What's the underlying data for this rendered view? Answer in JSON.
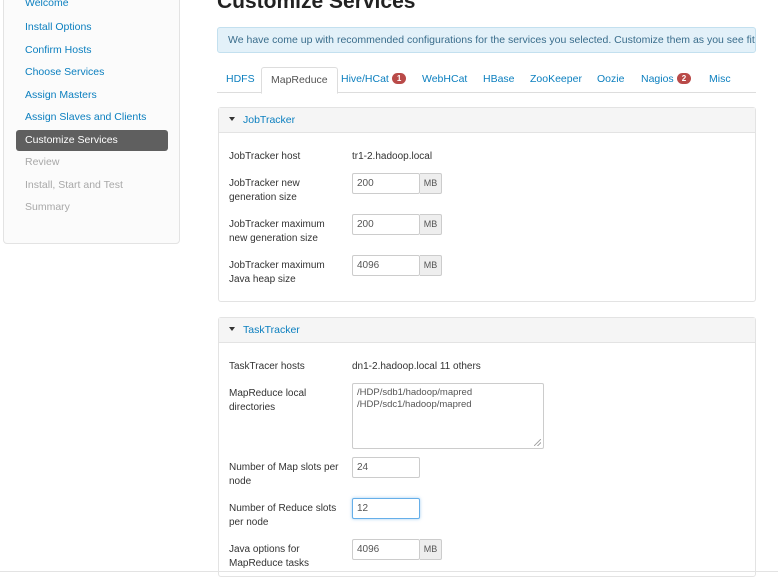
{
  "sidebar": {
    "items": [
      {
        "label": "Welcome"
      },
      {
        "label": "Install Options"
      },
      {
        "label": "Confirm Hosts"
      },
      {
        "label": "Choose Services"
      },
      {
        "label": "Assign Masters"
      },
      {
        "label": "Assign Slaves and Clients"
      },
      {
        "label": "Customize Services"
      },
      {
        "label": "Review"
      },
      {
        "label": "Install, Start and Test"
      },
      {
        "label": "Summary"
      }
    ]
  },
  "page": {
    "title": "Customize Services",
    "alert": "We have come up with recommended configurations for the services you selected. Customize them as you see fit."
  },
  "tabs": [
    {
      "label": "HDFS"
    },
    {
      "label": "MapReduce"
    },
    {
      "label": "Hive/HCat",
      "badge": "1"
    },
    {
      "label": "WebHCat"
    },
    {
      "label": "HBase"
    },
    {
      "label": "ZooKeeper"
    },
    {
      "label": "Oozie"
    },
    {
      "label": "Nagios",
      "badge": "2"
    },
    {
      "label": "Misc"
    }
  ],
  "jobtracker": {
    "title": "JobTracker",
    "host_label": "JobTracker host",
    "host_value": "tr1-2.hadoop.local",
    "newgen_label": "JobTracker new generation size",
    "newgen_value": "200",
    "newgen_unit": "MB",
    "maxnewgen_label": "JobTracker maximum new generation size",
    "maxnewgen_value": "200",
    "maxnewgen_unit": "MB",
    "heap_label": "JobTracker maximum Java heap size",
    "heap_value": "4096",
    "heap_unit": "MB"
  },
  "tasktracker": {
    "title": "TaskTracker",
    "hosts_label": "TaskTracer hosts",
    "hosts_value": "dn1-2.hadoop.local 11 others",
    "localdirs_label": "MapReduce local directories",
    "localdirs_value": "/HDP/sdb1/hadoop/mapred\n/HDP/sdc1/hadoop/mapred",
    "mapslots_label": "Number of Map slots per node",
    "mapslots_value": "24",
    "reduceslots_label": "Number of Reduce slots per node",
    "reduceslots_value": "12",
    "javaopts_label": "Java options for MapReduce tasks",
    "javaopts_value": "4096",
    "javaopts_unit": "MB"
  }
}
